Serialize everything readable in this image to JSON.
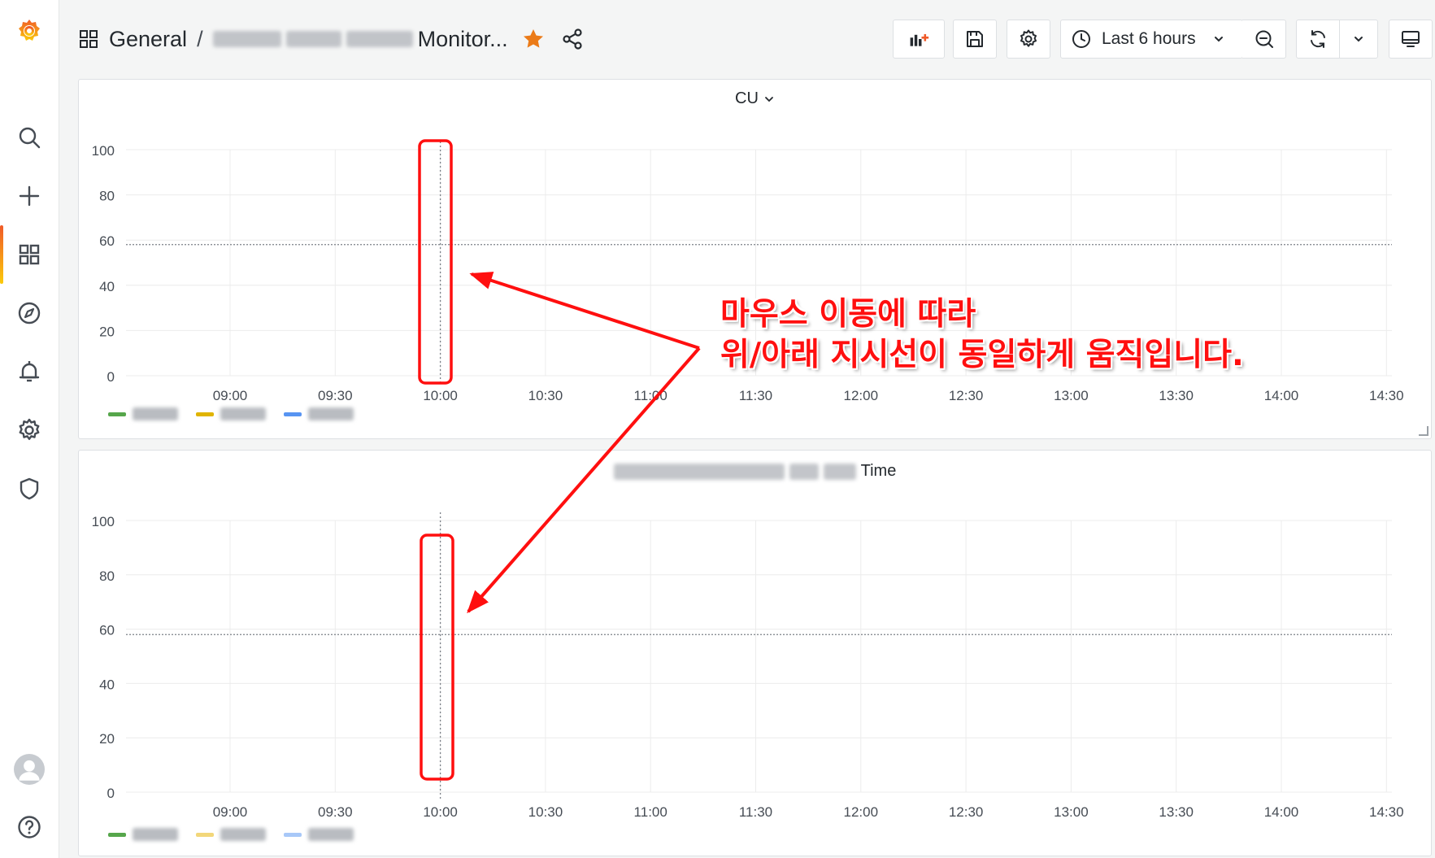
{
  "breadcrumb": {
    "folder": "General",
    "separator": "/",
    "dashboard_suffix": "Monitor..."
  },
  "toolbar": {
    "time_range": "Last 6 hours"
  },
  "sidebar": {
    "icons": [
      "search-icon",
      "plus-icon",
      "dashboards-icon",
      "explore-icon",
      "alerting-icon",
      "settings-icon",
      "shield-icon",
      "avatar",
      "help-icon"
    ]
  },
  "panels": [
    {
      "title": "CU",
      "legend_colors": [
        "#56a64b",
        "#e0b400",
        "#5794f2"
      ]
    },
    {
      "title_suffix": "Time",
      "legend_colors": [
        "#56a64b",
        "#f2d77a",
        "#a8c8f8"
      ]
    }
  ],
  "chart_data": [
    {
      "type": "line",
      "title": "CU",
      "y_ticks": [
        "100",
        "80",
        "60",
        "40",
        "20",
        "0"
      ],
      "x_ticks": [
        "09:00",
        "09:30",
        "10:00",
        "10:30",
        "11:00",
        "11:30",
        "12:00",
        "12:30",
        "13:00",
        "13:30",
        "14:00",
        "14:30"
      ],
      "ylim": [
        0,
        100
      ],
      "threshold": 58,
      "crosshair_x": "10:00"
    },
    {
      "type": "line",
      "title": "Time",
      "y_ticks": [
        "100",
        "80",
        "60",
        "40",
        "20",
        "0"
      ],
      "x_ticks": [
        "09:00",
        "09:30",
        "10:00",
        "10:30",
        "11:00",
        "11:30",
        "12:00",
        "12:30",
        "13:00",
        "13:30",
        "14:00",
        "14:30"
      ],
      "ylim": [
        0,
        100
      ],
      "threshold": 58,
      "crosshair_x": "10:00"
    }
  ],
  "annotation": {
    "line1": "마우스 이동에 따라",
    "line2": "위/아래 지시선이 동일하게 움직입니다.",
    "color": "#ff0f0f"
  },
  "colors": {
    "grafana_orange": "#f05a28",
    "star": "#eb7b18"
  }
}
